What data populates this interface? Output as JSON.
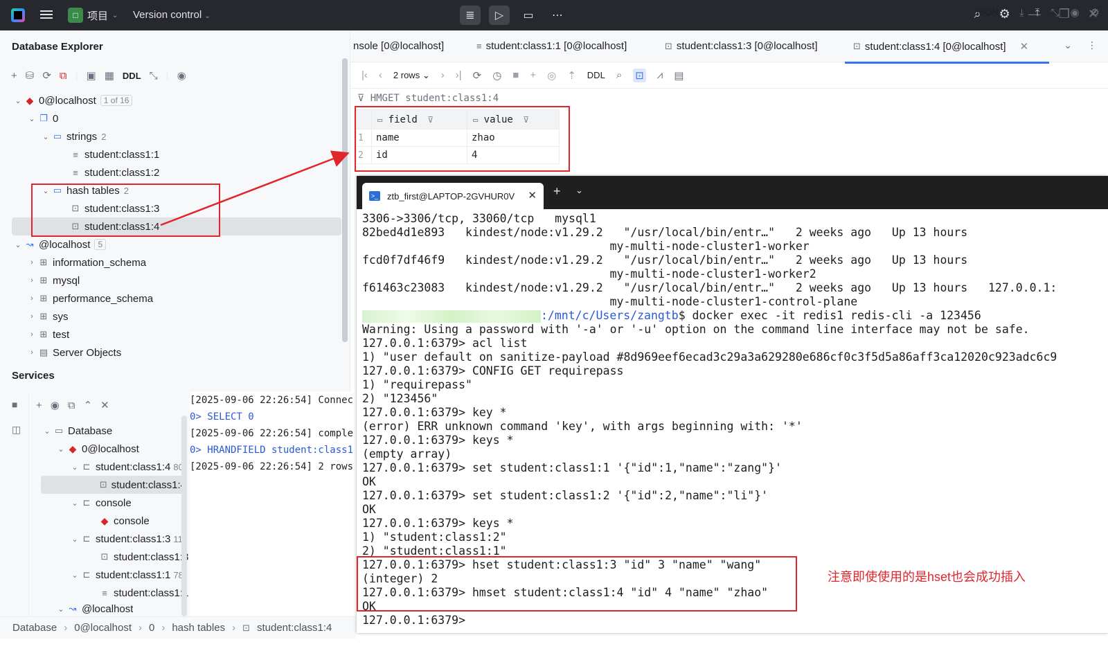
{
  "titlebar": {
    "project_badge": "□",
    "project_label": "项目",
    "vc_label": "Version control",
    "logo": "jetbrains-logo"
  },
  "db_explorer": {
    "title": "Database Explorer",
    "ddl_label": "DDL",
    "tree": {
      "host": "0@localhost",
      "host_meta": "1 of 16",
      "db": "0",
      "strings_label": "strings",
      "strings_count": "2",
      "strings_items": [
        "student:class1:1",
        "student:class1:2"
      ],
      "hash_label": "hash tables",
      "hash_count": "2",
      "hash_items": [
        "student:class1:3",
        "student:class1:4"
      ],
      "mysql_host": "@localhost",
      "mysql_count": "5",
      "schemas": [
        "information_schema",
        "mysql",
        "performance_schema",
        "sys",
        "test"
      ],
      "server_objects": "Server Objects"
    }
  },
  "services": {
    "title": "Services",
    "tree": {
      "root": "Database",
      "host": "0@localhost",
      "s4": "student:class1:4",
      "s4_meta": "80",
      "s4_child": "student:class1:4",
      "console": "console",
      "console_child": "console",
      "s3": "student:class1:3",
      "s3_meta": "11",
      "s3_child": "student:class1:3",
      "s1": "student:class1:1",
      "s1_meta": "78",
      "s1_child": "student:class1:1",
      "mysql_host": "@localhost"
    },
    "log": [
      "[2025-09-06 22:26:54] Connec",
      "0> SELECT 0",
      "[2025-09-06 22:26:54] comple",
      "0> HRANDFIELD student:class1",
      "[2025-09-06 22:26:54] 2 rows"
    ]
  },
  "statusbar": {
    "crumbs": [
      "Database",
      "0@localhost",
      "0",
      "hash tables",
      "student:class1:4"
    ]
  },
  "editor": {
    "tabs": [
      "nsole [0@localhost]",
      "student:class1:1 [0@localhost]",
      "student:class1:3 [0@localhost]",
      "student:class1:4 [0@localhost]"
    ],
    "rows_label": "2 rows",
    "ddl_label": "DDL",
    "format_label": "JSON",
    "query": "HMGET student:class1:4",
    "columns": [
      "field",
      "value"
    ],
    "rows": [
      {
        "n": "1",
        "field": "name",
        "value": "zhao"
      },
      {
        "n": "2",
        "field": "id",
        "value": "4"
      }
    ]
  },
  "terminal": {
    "tab_title": "ztb_first@LAPTOP-2GVHUR0V",
    "prompt_path": ":/mnt/c/Users/zangtb",
    "prompt_cmd": "$ docker exec -it redis1 redis-cli -a 123456",
    "lines": [
      "3306->3306/tcp, 33060/tcp   mysql1",
      "82bed4d1e893   kindest/node:v1.29.2   \"/usr/local/bin/entr…\"   2 weeks ago   Up 13 hours",
      "                                    my-multi-node-cluster1-worker",
      "fcd0f7df46f9   kindest/node:v1.29.2   \"/usr/local/bin/entr…\"   2 weeks ago   Up 13 hours",
      "                                    my-multi-node-cluster1-worker2",
      "f61463c23083   kindest/node:v1.29.2   \"/usr/local/bin/entr…\"   2 weeks ago   Up 13 hours   127.0.0.1:",
      "                                    my-multi-node-cluster1-control-plane"
    ],
    "lines2": [
      "Warning: Using a password with '-a' or '-u' option on the command line interface may not be safe.",
      "127.0.0.1:6379> acl list",
      "1) \"user default on sanitize-payload #8d969eef6ecad3c29a3a629280e686cf0c3f5d5a86aff3ca12020c923adc6c9",
      "127.0.0.1:6379> CONFIG GET requirepass",
      "1) \"requirepass\"",
      "2) \"123456\"",
      "127.0.0.1:6379> key *",
      "(error) ERR unknown command 'key', with args beginning with: '*'",
      "127.0.0.1:6379> keys *",
      "(empty array)",
      "127.0.0.1:6379> set student:class1:1 '{\"id\":1,\"name\":\"zang\"}'",
      "OK",
      "127.0.0.1:6379> set student:class1:2 '{\"id\":2,\"name\":\"li\"}'",
      "OK",
      "127.0.0.1:6379> keys *",
      "1) \"student:class1:2\"",
      "2) \"student:class1:1\"",
      "127.0.0.1:6379> hset student:class1:3 \"id\" 3 \"name\" \"wang\"",
      "(integer) 2",
      "127.0.0.1:6379> hmset student:class1:4 \"id\" 4 \"name\" \"zhao\"",
      "OK",
      "127.0.0.1:6379> "
    ]
  },
  "annotation": "注意即使使用的是hset也会成功插入",
  "colors": {
    "annotation_red": "#e0252b",
    "accent_blue": "#3574f0",
    "redis_red": "#d6262b"
  }
}
